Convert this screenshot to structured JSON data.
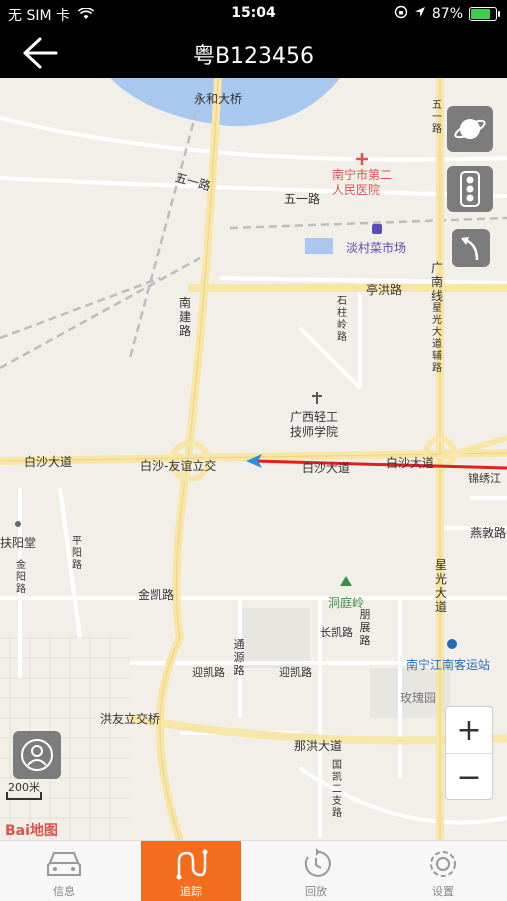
{
  "status_bar": {
    "carrier": "无 SIM 卡",
    "time": "15:04",
    "battery_percent": "87%",
    "battery_level": 0.87
  },
  "nav": {
    "title": "粤B123456"
  },
  "map": {
    "labels": {
      "bridge": "永和大桥",
      "hospital": "南宁市第二\n人民医院",
      "wuyi_road_1": "五一路",
      "wuyi_road_2": "五一路",
      "market": "淡村菜市场",
      "tinghong_road": "亭洪路",
      "guangnan_line": "广南线",
      "xingguang_ave_aux": "星光大道辅路",
      "nanjian_road": "南建路",
      "shizhu_road": "石柱岭路",
      "school": "广西轻工\n技师学院",
      "baisha_ave_1": "白沙大道",
      "interchange": "白沙-友谊立交",
      "baisha_ave_2": "白沙大道",
      "baisha_ave_3": "白沙大道",
      "jinjiang": "锦绣江",
      "yanjiao_road": "燕敦路",
      "fuyangtang": "扶阳堂",
      "jinyang_road": "金阳路",
      "pingyang_road": "平阳路",
      "jinkai_road": "金凯路",
      "xingguang_ave": "星光大道",
      "dongting": "洞庭岭",
      "changkai_road": "长凯路",
      "pengzhan_road": "朋展路",
      "tongyuan_road": "通源路",
      "yingkai_road_1": "迎凯路",
      "yingkai_road_2": "迎凯路",
      "bus_station": "南宁江南客运站",
      "meiguiyuan": "玫瑰园",
      "hongyou_interchange": "洪友立交桥",
      "naxiang_ave": "那洪大道",
      "guokai_road": "国凯二支路",
      "wuyi_road_vertical": "五一路"
    },
    "scale": "200米",
    "logo": "Bai地图",
    "zoom_in": "+",
    "zoom_out": "−"
  },
  "tabs": [
    {
      "label": "信息",
      "icon": "car-icon"
    },
    {
      "label": "追踪",
      "icon": "track-icon"
    },
    {
      "label": "回放",
      "icon": "replay-icon"
    },
    {
      "label": "设置",
      "icon": "gear-icon"
    }
  ],
  "colors": {
    "accent": "#f36d1f",
    "route": "#e02020",
    "water": "#a8c8f0"
  }
}
